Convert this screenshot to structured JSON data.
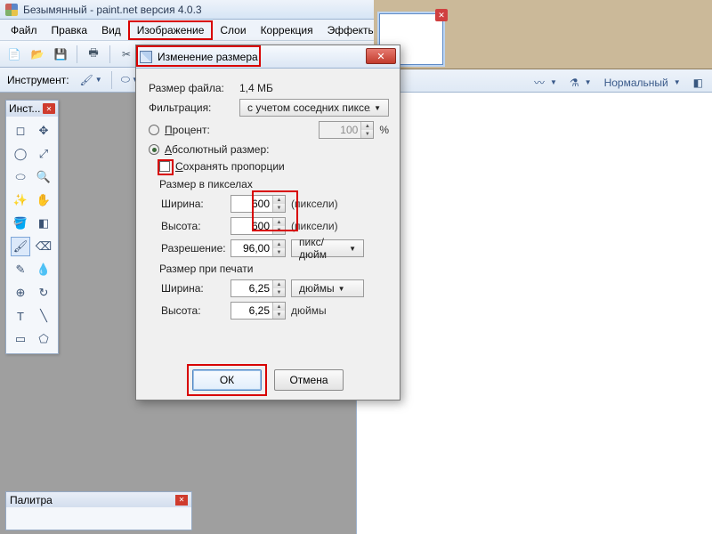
{
  "window": {
    "title": "Безымянный - paint.net версия 4.0.3"
  },
  "menu": {
    "file": "Файл",
    "edit": "Правка",
    "view": "Вид",
    "image": "Изображение",
    "layers": "Слои",
    "adjust": "Коррекция",
    "effects": "Эффекты"
  },
  "strip": {
    "tool_label": "Инструмент:"
  },
  "right_strip": {
    "mode": "Нормальный"
  },
  "tools_window": {
    "title": "Инст..."
  },
  "palette_window": {
    "title": "Палитра"
  },
  "dialog": {
    "title": "Изменение размера",
    "filesize_label": "Размер файла:",
    "filesize_value": "1,4 МБ",
    "filter_label": "Фильтрация:",
    "filter_value": "с учетом соседних пикселов",
    "percent_label": "Процент:",
    "percent_value": "100",
    "percent_unit": "%",
    "absolute_label": "Абсолютный размер:",
    "keep_aspect": "Сохранять пропорции",
    "pixel_group": "Размер в пикселах",
    "width_label": "Ширина:",
    "height_label": "Высота:",
    "width_px": "600",
    "height_px": "600",
    "px_unit": "(пиксели)",
    "resolution_label": "Разрешение:",
    "resolution_value": "96,00",
    "res_unit": "пикс/дюйм",
    "print_group": "Размер при печати",
    "width_print": "6,25",
    "height_print": "6,25",
    "print_unit": "дюймы",
    "ok": "ОК",
    "cancel": "Отмена"
  }
}
